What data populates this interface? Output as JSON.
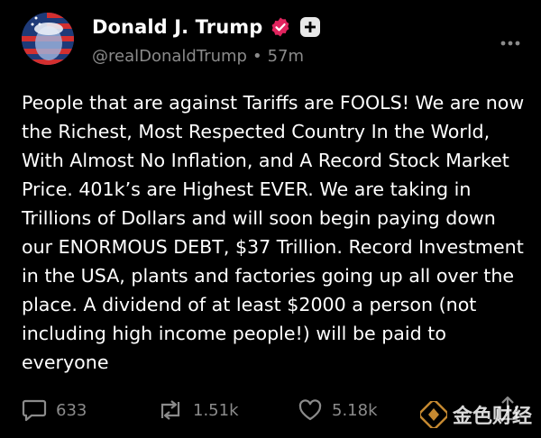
{
  "post": {
    "author_name": "Donald J. Trump",
    "handle": "@realDonaldTrump",
    "separator": "•",
    "time": "57m",
    "text": "People that are against Tariffs are FOOLS! We are now the Richest, Most Respected Country In the World, With Almost No Inflation, and A Record Stock Market Price. 401k’s are Highest EVER. We are taking in Trillions of Dollars and will soon begin paying down our ENORMOUS DEBT, $37 Trillion. Record Investment in the USA, plants and factories going up all over the place. A dividend of at least $2000 a person (not including high income people!) will be paid to everyone"
  },
  "actions": {
    "replies": "633",
    "reposts": "1.51k",
    "likes": "5.18k"
  },
  "icons": {
    "verified": "verified-badge-icon",
    "follow": "plus-icon",
    "more": "more-dots-icon",
    "reply": "comment-icon",
    "repost": "repost-icon",
    "like": "heart-icon",
    "share": "share-icon"
  },
  "watermark": {
    "text": "金色财经"
  },
  "colors": {
    "background": "#000000",
    "text": "#ffffff",
    "muted": "#8b8b8b",
    "verified": "#e0245e",
    "watermark_accent": "#e8a23a"
  }
}
